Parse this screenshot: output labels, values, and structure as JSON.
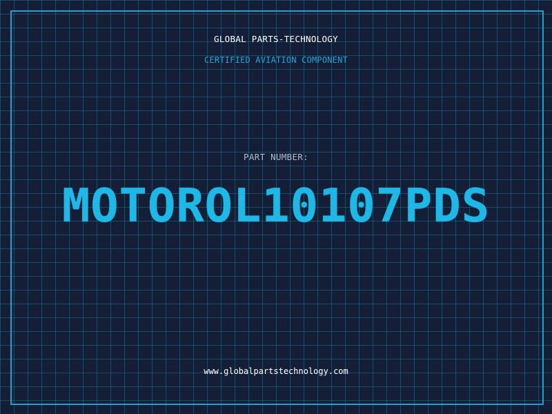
{
  "header": {
    "company": "GLOBAL PARTS-TECHNOLOGY",
    "subtitle": "CERTIFIED AVIATION COMPONENT"
  },
  "part": {
    "label": "PART NUMBER:",
    "number": "MOTOROL10107PDS"
  },
  "footer": {
    "url": "www.globalpartstechnology.com"
  },
  "colors": {
    "background": "#141e36",
    "grid": "#266e8c",
    "accent": "#1fb8e6",
    "frame": "#1fa0cf"
  }
}
